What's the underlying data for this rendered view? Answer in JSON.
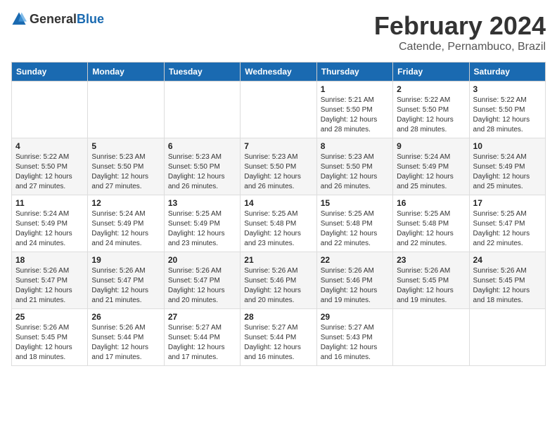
{
  "logo": {
    "general": "General",
    "blue": "Blue"
  },
  "title": "February 2024",
  "subtitle": "Catende, Pernambuco, Brazil",
  "weekdays": [
    "Sunday",
    "Monday",
    "Tuesday",
    "Wednesday",
    "Thursday",
    "Friday",
    "Saturday"
  ],
  "weeks": [
    [
      {
        "day": "",
        "info": ""
      },
      {
        "day": "",
        "info": ""
      },
      {
        "day": "",
        "info": ""
      },
      {
        "day": "",
        "info": ""
      },
      {
        "day": "1",
        "info": "Sunrise: 5:21 AM\nSunset: 5:50 PM\nDaylight: 12 hours and 28 minutes."
      },
      {
        "day": "2",
        "info": "Sunrise: 5:22 AM\nSunset: 5:50 PM\nDaylight: 12 hours and 28 minutes."
      },
      {
        "day": "3",
        "info": "Sunrise: 5:22 AM\nSunset: 5:50 PM\nDaylight: 12 hours and 28 minutes."
      }
    ],
    [
      {
        "day": "4",
        "info": "Sunrise: 5:22 AM\nSunset: 5:50 PM\nDaylight: 12 hours and 27 minutes."
      },
      {
        "day": "5",
        "info": "Sunrise: 5:23 AM\nSunset: 5:50 PM\nDaylight: 12 hours and 27 minutes."
      },
      {
        "day": "6",
        "info": "Sunrise: 5:23 AM\nSunset: 5:50 PM\nDaylight: 12 hours and 26 minutes."
      },
      {
        "day": "7",
        "info": "Sunrise: 5:23 AM\nSunset: 5:50 PM\nDaylight: 12 hours and 26 minutes."
      },
      {
        "day": "8",
        "info": "Sunrise: 5:23 AM\nSunset: 5:50 PM\nDaylight: 12 hours and 26 minutes."
      },
      {
        "day": "9",
        "info": "Sunrise: 5:24 AM\nSunset: 5:49 PM\nDaylight: 12 hours and 25 minutes."
      },
      {
        "day": "10",
        "info": "Sunrise: 5:24 AM\nSunset: 5:49 PM\nDaylight: 12 hours and 25 minutes."
      }
    ],
    [
      {
        "day": "11",
        "info": "Sunrise: 5:24 AM\nSunset: 5:49 PM\nDaylight: 12 hours and 24 minutes."
      },
      {
        "day": "12",
        "info": "Sunrise: 5:24 AM\nSunset: 5:49 PM\nDaylight: 12 hours and 24 minutes."
      },
      {
        "day": "13",
        "info": "Sunrise: 5:25 AM\nSunset: 5:49 PM\nDaylight: 12 hours and 23 minutes."
      },
      {
        "day": "14",
        "info": "Sunrise: 5:25 AM\nSunset: 5:48 PM\nDaylight: 12 hours and 23 minutes."
      },
      {
        "day": "15",
        "info": "Sunrise: 5:25 AM\nSunset: 5:48 PM\nDaylight: 12 hours and 22 minutes."
      },
      {
        "day": "16",
        "info": "Sunrise: 5:25 AM\nSunset: 5:48 PM\nDaylight: 12 hours and 22 minutes."
      },
      {
        "day": "17",
        "info": "Sunrise: 5:25 AM\nSunset: 5:47 PM\nDaylight: 12 hours and 22 minutes."
      }
    ],
    [
      {
        "day": "18",
        "info": "Sunrise: 5:26 AM\nSunset: 5:47 PM\nDaylight: 12 hours and 21 minutes."
      },
      {
        "day": "19",
        "info": "Sunrise: 5:26 AM\nSunset: 5:47 PM\nDaylight: 12 hours and 21 minutes."
      },
      {
        "day": "20",
        "info": "Sunrise: 5:26 AM\nSunset: 5:47 PM\nDaylight: 12 hours and 20 minutes."
      },
      {
        "day": "21",
        "info": "Sunrise: 5:26 AM\nSunset: 5:46 PM\nDaylight: 12 hours and 20 minutes."
      },
      {
        "day": "22",
        "info": "Sunrise: 5:26 AM\nSunset: 5:46 PM\nDaylight: 12 hours and 19 minutes."
      },
      {
        "day": "23",
        "info": "Sunrise: 5:26 AM\nSunset: 5:45 PM\nDaylight: 12 hours and 19 minutes."
      },
      {
        "day": "24",
        "info": "Sunrise: 5:26 AM\nSunset: 5:45 PM\nDaylight: 12 hours and 18 minutes."
      }
    ],
    [
      {
        "day": "25",
        "info": "Sunrise: 5:26 AM\nSunset: 5:45 PM\nDaylight: 12 hours and 18 minutes."
      },
      {
        "day": "26",
        "info": "Sunrise: 5:26 AM\nSunset: 5:44 PM\nDaylight: 12 hours and 17 minutes."
      },
      {
        "day": "27",
        "info": "Sunrise: 5:27 AM\nSunset: 5:44 PM\nDaylight: 12 hours and 17 minutes."
      },
      {
        "day": "28",
        "info": "Sunrise: 5:27 AM\nSunset: 5:44 PM\nDaylight: 12 hours and 16 minutes."
      },
      {
        "day": "29",
        "info": "Sunrise: 5:27 AM\nSunset: 5:43 PM\nDaylight: 12 hours and 16 minutes."
      },
      {
        "day": "",
        "info": ""
      },
      {
        "day": "",
        "info": ""
      }
    ]
  ]
}
